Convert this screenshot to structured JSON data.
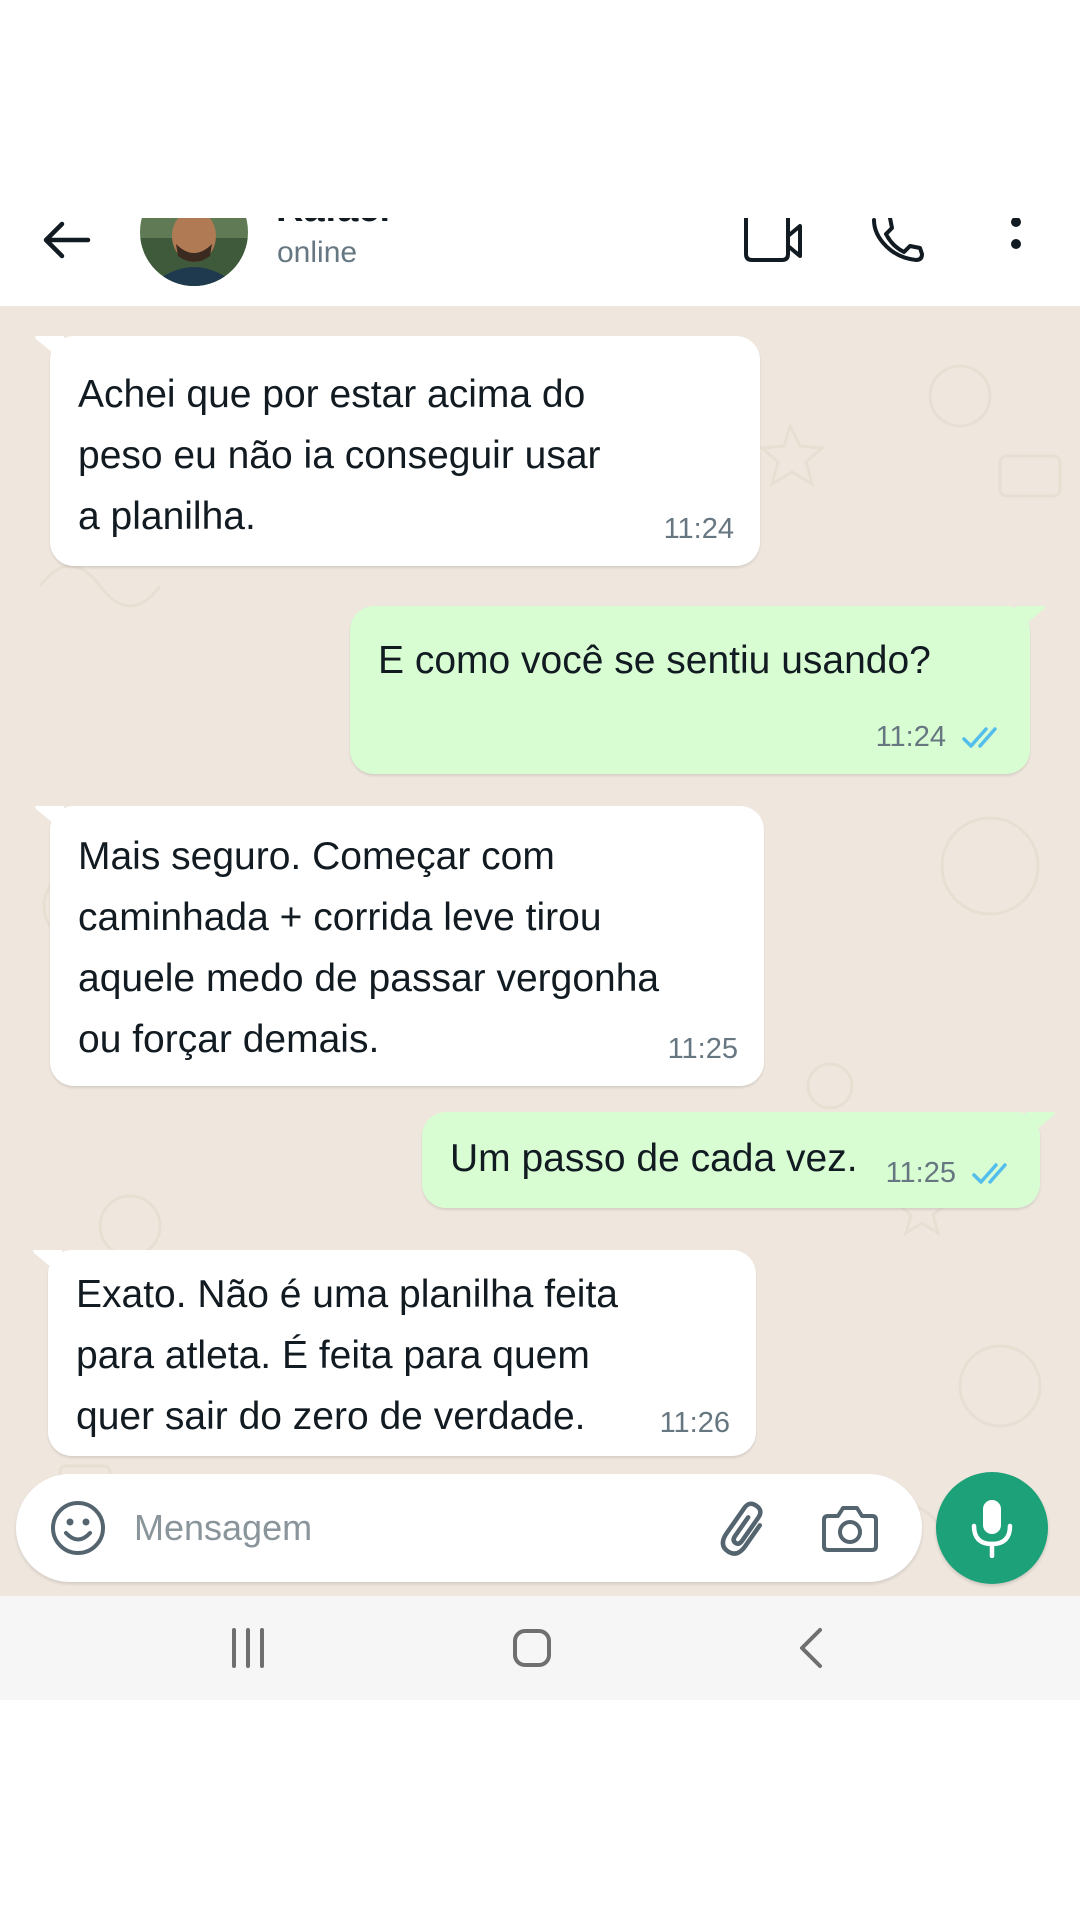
{
  "header": {
    "contact_name": "Rafael",
    "status": "online"
  },
  "messages": [
    {
      "direction": "in",
      "text": "Achei que por estar acima do\npeso eu não ia conseguir usar\na planilha.",
      "time": "11:24"
    },
    {
      "direction": "out",
      "text": "E como você se sentiu usando?",
      "time": "11:24",
      "read": true
    },
    {
      "direction": "in",
      "text": "Mais seguro. Começar com\ncaminhada + corrida leve tirou\naquele medo de passar vergonha\nou forçar demais.",
      "time": "11:25"
    },
    {
      "direction": "out",
      "text": "Um passo de cada vez.",
      "time": "11:25",
      "read": true
    },
    {
      "direction": "in",
      "text": "Exato. Não é uma planilha feita\npara atleta. É feita para quem\nquer sair do zero de verdade.",
      "time": "11:26"
    }
  ],
  "composer": {
    "placeholder": "Mensagem"
  },
  "icons": {
    "back": "arrow-left",
    "video": "video-camera",
    "call": "phone",
    "menu": "more-vertical",
    "emoji": "smiley",
    "attach": "paperclip",
    "camera": "camera",
    "mic": "microphone",
    "read_receipt": "double-check"
  },
  "colors": {
    "accent": "#1da179",
    "outgoing_bubble": "#d9fdd3",
    "incoming_bubble": "#ffffff",
    "chat_background": "#efe7de",
    "read_tick": "#53bdeb"
  }
}
